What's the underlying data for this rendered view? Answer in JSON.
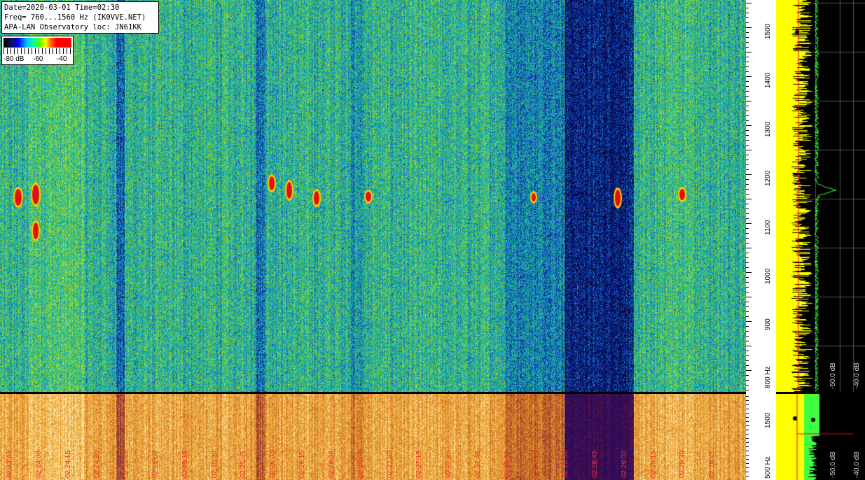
{
  "info": {
    "line1": "Date=2020-03-01 Time=02:30",
    "line2": "Freq= 760...1560 Hz (IK0VVE.NET)",
    "line3": "APA-LAN Observatory loc: JN61KK"
  },
  "colorbar": {
    "labels": [
      "-80 dB",
      "-60",
      "-40"
    ]
  },
  "freq_scale_top": {
    "labels": [
      "1500",
      "1400",
      "1300",
      "1200",
      "1100",
      "1000",
      "900",
      "800 Hz"
    ],
    "values": [
      1500,
      1400,
      1300,
      1200,
      1100,
      1000,
      900,
      800
    ],
    "range": [
      760,
      1560
    ]
  },
  "freq_scale_bottom": {
    "labels": [
      "1500",
      "500 Hz"
    ],
    "values": [
      1500,
      500
    ]
  },
  "spectrum_top_db_labels": [
    "-50.0 dB",
    "-40.0 dB"
  ],
  "spectrum_bottom_db_labels": [
    "-50.0 dB",
    "-40.0 dB"
  ],
  "time_labels": [
    "02:23:45",
    "02:24:00",
    "02:24:15",
    "02:24:30",
    "02:24:45",
    "02:25:00",
    "02:25:15",
    "02:25:30",
    "02:25:45",
    "02:26:00",
    "02:26:15",
    "02:26:30",
    "02:26:45",
    "02:27:00",
    "02:27:15",
    "02:27:30",
    "02:27:45",
    "02:28:00",
    "02:28:15",
    "02:28:30",
    "02:28:45",
    "02:29:00",
    "02:29:15",
    "02:29:30",
    "02:29:45"
  ],
  "colors": {
    "time_label": "#ff2a2a",
    "accent_red": "#ff0000",
    "spectrum_yellow": "#ffff00",
    "spectrum_green": "#40ff40"
  }
}
